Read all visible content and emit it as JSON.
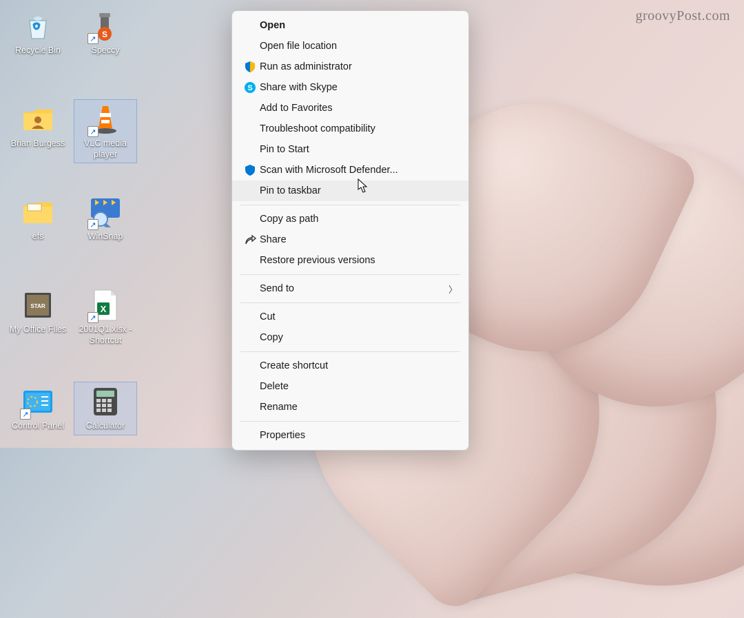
{
  "watermark": "groovyPost.com",
  "desktop": {
    "icons": [
      {
        "label": "Recycle Bin",
        "selected": false,
        "shortcut": false
      },
      {
        "label": "Speccy",
        "selected": false,
        "shortcut": true
      },
      {
        "label": "Brian Burgess",
        "selected": false,
        "shortcut": false
      },
      {
        "label": "VLC media player",
        "selected": true,
        "shortcut": true
      },
      {
        "label": "efs",
        "selected": false,
        "shortcut": false
      },
      {
        "label": "WinSnap",
        "selected": false,
        "shortcut": true
      },
      {
        "label": "My Office Files",
        "selected": false,
        "shortcut": false
      },
      {
        "label": "2001Q1.xlsx - Shortcut",
        "selected": false,
        "shortcut": true
      },
      {
        "label": "Control Panel",
        "selected": false,
        "shortcut": true
      },
      {
        "label": "Calculator",
        "selected": true,
        "shortcut": false
      }
    ]
  },
  "context_menu": {
    "groups": [
      [
        {
          "label": "Open",
          "bold": true,
          "icon": ""
        },
        {
          "label": "Open file location",
          "icon": ""
        },
        {
          "label": "Run as administrator",
          "icon": "shield-admin"
        },
        {
          "label": "Share with Skype",
          "icon": "skype"
        },
        {
          "label": "Add to Favorites",
          "icon": ""
        },
        {
          "label": "Troubleshoot compatibility",
          "icon": ""
        },
        {
          "label": "Pin to Start",
          "icon": ""
        },
        {
          "label": "Scan with Microsoft Defender...",
          "icon": "defender"
        },
        {
          "label": "Pin to taskbar",
          "icon": "",
          "hover": true
        }
      ],
      [
        {
          "label": "Copy as path",
          "icon": ""
        },
        {
          "label": "Share",
          "icon": "share"
        },
        {
          "label": "Restore previous versions",
          "icon": ""
        }
      ],
      [
        {
          "label": "Send to",
          "icon": "",
          "submenu": true
        }
      ],
      [
        {
          "label": "Cut",
          "icon": ""
        },
        {
          "label": "Copy",
          "icon": ""
        }
      ],
      [
        {
          "label": "Create shortcut",
          "icon": ""
        },
        {
          "label": "Delete",
          "icon": ""
        },
        {
          "label": "Rename",
          "icon": ""
        }
      ],
      [
        {
          "label": "Properties",
          "icon": ""
        }
      ]
    ]
  }
}
